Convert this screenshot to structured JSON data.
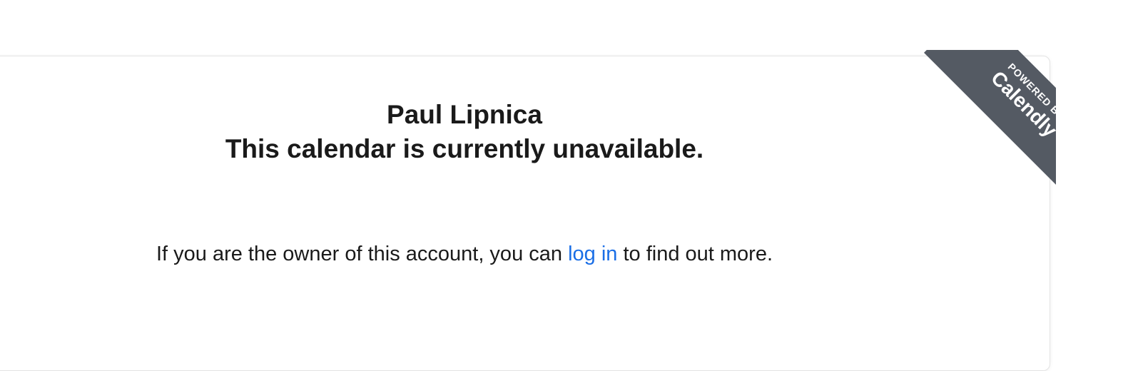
{
  "owner_name": "Paul Lipnica",
  "status_heading": "This calendar is currently unavailable.",
  "message": {
    "before": "If you are the owner of this account, you can ",
    "link_label": "log in",
    "after": " to find out more."
  },
  "ribbon": {
    "powered_by": "POWERED BY",
    "brand": "Calendly"
  },
  "colors": {
    "link": "#1a6ee6",
    "ribbon": "#545a63",
    "text": "#1a1a1a"
  }
}
